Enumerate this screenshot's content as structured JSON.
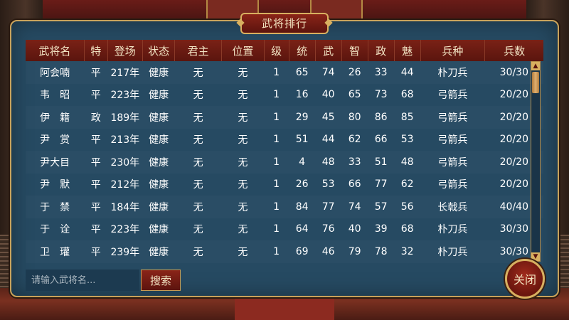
{
  "window": {
    "title": "武将排行"
  },
  "table": {
    "headers": [
      "武将名",
      "特",
      "登场",
      "状态",
      "君主",
      "位置",
      "级",
      "统",
      "武",
      "智",
      "政",
      "魅",
      "兵种",
      "兵数"
    ],
    "rows": [
      [
        "阿会喃",
        "平",
        "217年",
        "健康",
        "无",
        "无",
        "1",
        "65",
        "74",
        "26",
        "33",
        "44",
        "朴刀兵",
        "30/30"
      ],
      [
        "韦　昭",
        "平",
        "223年",
        "健康",
        "无",
        "无",
        "1",
        "16",
        "40",
        "65",
        "73",
        "68",
        "弓箭兵",
        "20/20"
      ],
      [
        "伊　籍",
        "政",
        "189年",
        "健康",
        "无",
        "无",
        "1",
        "29",
        "45",
        "80",
        "86",
        "85",
        "弓箭兵",
        "20/20"
      ],
      [
        "尹　赏",
        "平",
        "213年",
        "健康",
        "无",
        "无",
        "1",
        "51",
        "44",
        "62",
        "66",
        "53",
        "弓箭兵",
        "20/20"
      ],
      [
        "尹大目",
        "平",
        "230年",
        "健康",
        "无",
        "无",
        "1",
        "4",
        "48",
        "33",
        "51",
        "48",
        "弓箭兵",
        "20/20"
      ],
      [
        "尹　默",
        "平",
        "212年",
        "健康",
        "无",
        "无",
        "1",
        "26",
        "53",
        "66",
        "77",
        "62",
        "弓箭兵",
        "20/20"
      ],
      [
        "于　禁",
        "平",
        "184年",
        "健康",
        "无",
        "无",
        "1",
        "84",
        "77",
        "74",
        "57",
        "56",
        "长戟兵",
        "40/40"
      ],
      [
        "于　诠",
        "平",
        "223年",
        "健康",
        "无",
        "无",
        "1",
        "64",
        "76",
        "40",
        "39",
        "68",
        "朴刀兵",
        "30/30"
      ],
      [
        "卫　瓘",
        "平",
        "239年",
        "健康",
        "无",
        "无",
        "1",
        "69",
        "46",
        "79",
        "78",
        "32",
        "朴刀兵",
        "30/30"
      ]
    ]
  },
  "search": {
    "placeholder": "请输入武将名...",
    "button_label": "搜索"
  },
  "close_label": "关闭",
  "icons": {
    "scroll_up": "scroll-up-arrow",
    "scroll_down": "scroll-down-arrow"
  },
  "colors": {
    "panel": "#264a62",
    "header": "#7a2116",
    "border_gold": "#c9a25a"
  }
}
